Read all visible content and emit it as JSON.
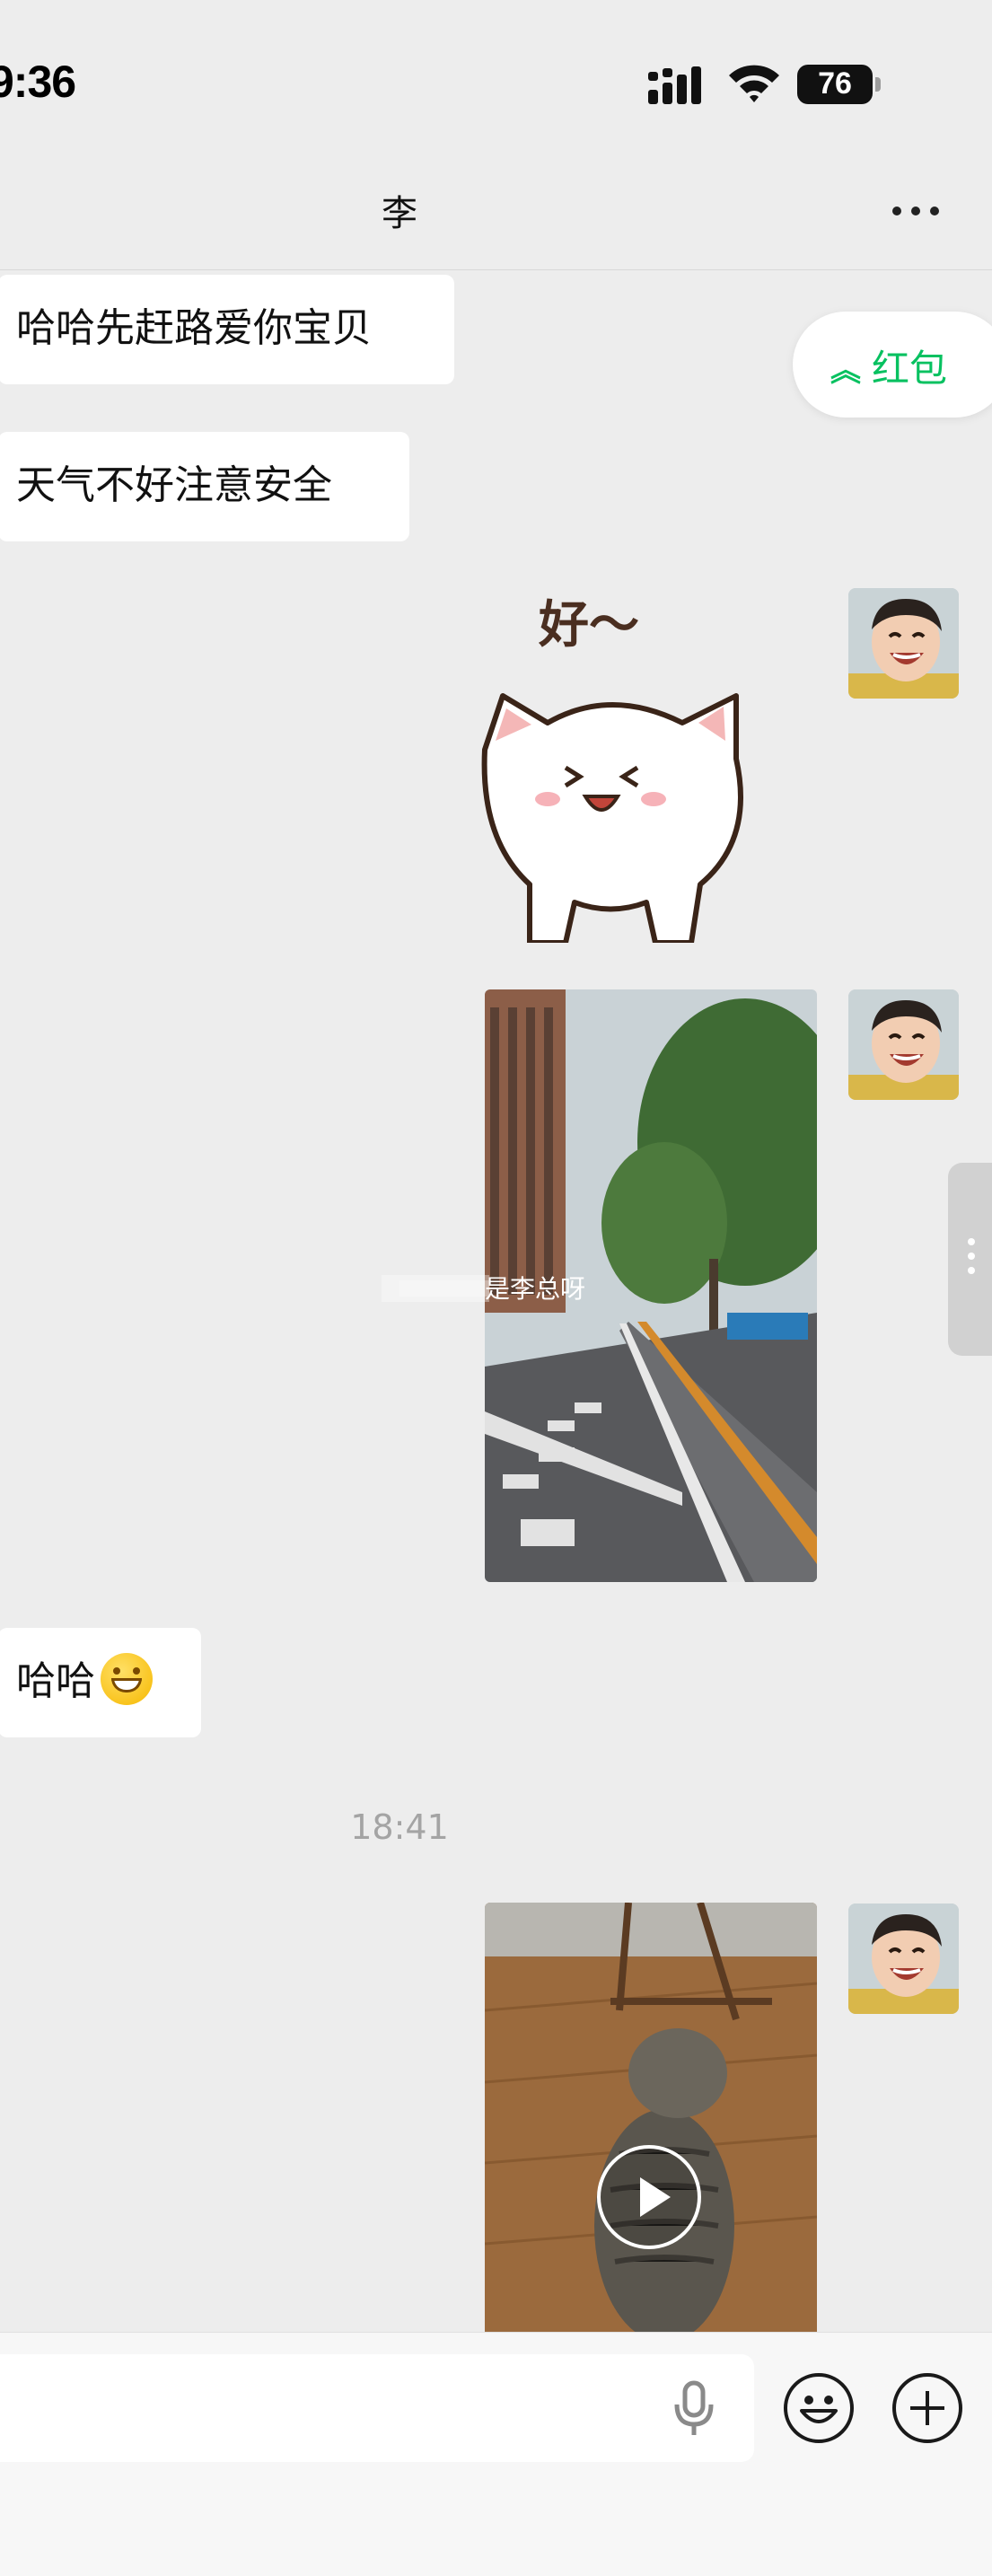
{
  "status_bar": {
    "time": "9:36",
    "battery": "76"
  },
  "nav": {
    "title": "李",
    "more_icon": "more-dots-icon"
  },
  "messages": [
    {
      "side": "left",
      "type": "text",
      "text": "哈哈先赶路爱你宝贝"
    },
    {
      "side": "left",
      "type": "text",
      "text": "天气不好注意安全"
    },
    {
      "side": "right",
      "type": "sticker",
      "text": "好～"
    },
    {
      "side": "right",
      "type": "image",
      "watermark": "是李总呀"
    },
    {
      "side": "left",
      "type": "text",
      "text": "哈哈"
    },
    {
      "type": "timestamp",
      "text": "18:41"
    },
    {
      "side": "right",
      "type": "video"
    }
  ],
  "red_packet": {
    "label": "红包",
    "icon": "double-chevron-up-icon"
  },
  "input": {
    "value": "",
    "mic_icon": "microphone-icon",
    "emoji_icon": "emoji-icon",
    "plus_icon": "plus-icon"
  },
  "colors": {
    "accent": "#07c160",
    "background": "#ededed",
    "bubble": "#ffffff"
  }
}
